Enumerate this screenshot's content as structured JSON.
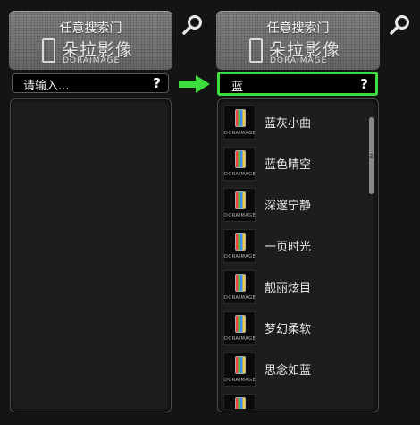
{
  "left_panel": {
    "title": "任意搜索门",
    "logo_text": "朵拉影像",
    "logo_sub": "DORAIMAGE",
    "search": {
      "value": "请输入...",
      "help_label": "?"
    }
  },
  "right_panel": {
    "title": "任意搜索门",
    "logo_text": "朵拉影像",
    "logo_sub": "DORAIMAGE",
    "search": {
      "value": "蓝",
      "help_label": "?"
    },
    "results": [
      {
        "name": "蓝灰小曲",
        "thumb_label": "DORAIMAGE"
      },
      {
        "name": "蓝色晴空",
        "thumb_label": "DORAIMAGE"
      },
      {
        "name": "深邃宁静",
        "thumb_label": "DORAIMAGE"
      },
      {
        "name": "一页时光",
        "thumb_label": "DORAIMAGE"
      },
      {
        "name": "靓丽炫目",
        "thumb_label": "DORAIMAGE"
      },
      {
        "name": "梦幻柔软",
        "thumb_label": "DORAIMAGE"
      },
      {
        "name": "思念如蓝",
        "thumb_label": "DORAIMAGE"
      },
      {
        "name": "",
        "thumb_label": ""
      }
    ]
  },
  "icons": {
    "search": "magnifier-icon",
    "arrow": "right-arrow-icon",
    "help": "question-mark"
  },
  "colors": {
    "accent_border": "#3ddc3d",
    "arrow": "#3ddc3d",
    "background": "#141414"
  }
}
